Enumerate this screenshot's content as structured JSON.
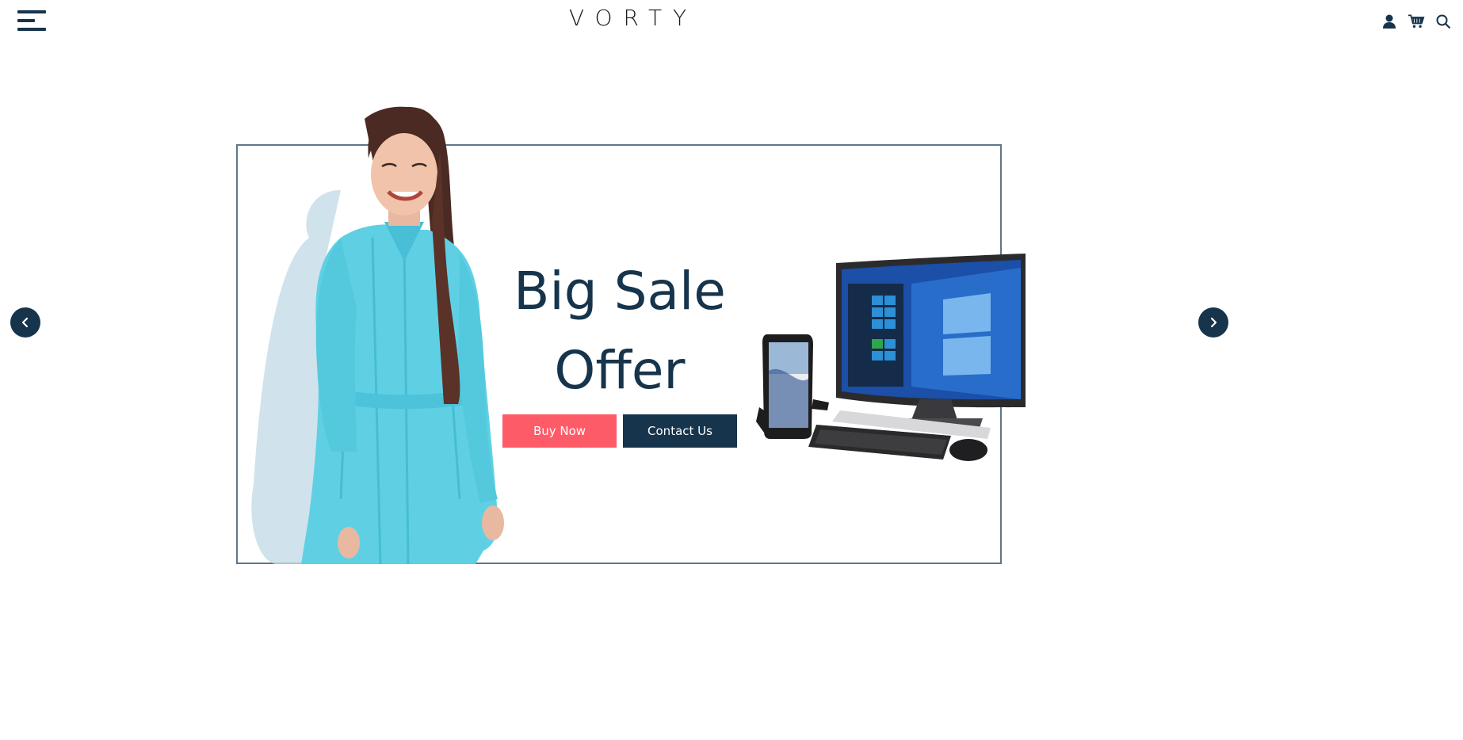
{
  "header": {
    "brand": "VORTY",
    "icons": [
      "menu-icon",
      "user-icon",
      "cart-icon",
      "search-icon"
    ]
  },
  "slider": {
    "headline_line1": "Big Sale",
    "headline_line2": "Offer",
    "buy_label": "Buy Now",
    "contact_label": "Contact Us",
    "prev_icon": "chevron-left-icon",
    "next_icon": "chevron-right-icon"
  },
  "colors": {
    "primary": "#16344c",
    "accent": "#fe5b69",
    "frame": "#5f7688",
    "background": "#ffffff"
  }
}
